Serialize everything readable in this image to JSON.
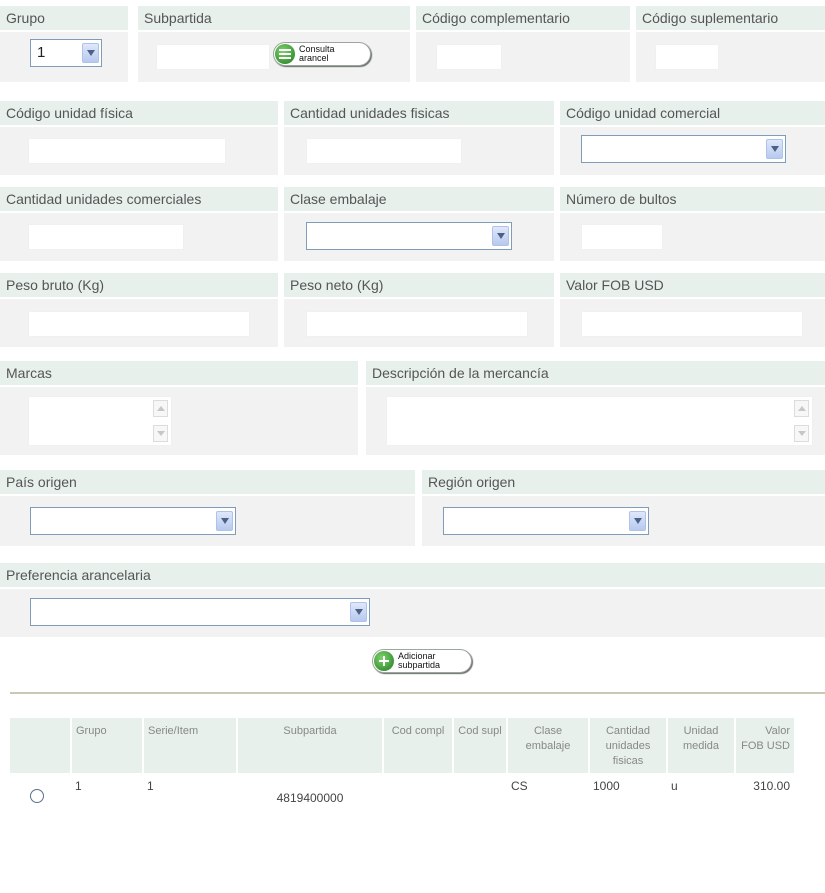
{
  "row1": {
    "grupo": {
      "label": "Grupo",
      "value": "1"
    },
    "subpartida": {
      "label": "Subpartida",
      "button_line1": "Consulta",
      "button_line2": "arancel"
    },
    "codigo_complementario": {
      "label": "Código complementario"
    },
    "codigo_suplementario": {
      "label": "Código suplementario"
    }
  },
  "row2": {
    "codigo_unidad_fisica": {
      "label": "Código unidad física"
    },
    "cantidad_unidades_fisicas": {
      "label": "Cantidad unidades fisicas"
    },
    "codigo_unidad_comercial": {
      "label": "Código unidad comercial"
    }
  },
  "row3": {
    "cantidad_unidades_comerciales": {
      "label": "Cantidad unidades comerciales"
    },
    "clase_embalaje": {
      "label": "Clase embalaje"
    },
    "numero_bultos": {
      "label": "Número de bultos"
    }
  },
  "row4": {
    "peso_bruto": {
      "label": "Peso bruto (Kg)"
    },
    "peso_neto": {
      "label": "Peso neto (Kg)"
    },
    "valor_fob": {
      "label": "Valor FOB USD"
    }
  },
  "row5": {
    "marcas": {
      "label": "Marcas"
    },
    "descripcion": {
      "label": "Descripción de la mercancía"
    }
  },
  "row6": {
    "pais_origen": {
      "label": "País origen"
    },
    "region_origen": {
      "label": "Región origen"
    }
  },
  "row7": {
    "preferencia": {
      "label": "Preferencia arancelaria"
    }
  },
  "add_button": {
    "line1": "Adicionar",
    "line2": "subpartida"
  },
  "table": {
    "headers": {
      "grupo": "Grupo",
      "serie": "Serie/Item",
      "subpartida": "Subpartida",
      "cod_compl": "Cod compl",
      "cod_supl": "Cod supl",
      "clase": "Clase embalaje",
      "cantidad": "Cantidad unidades fisicas",
      "unidad": "Unidad medida",
      "valor": "Valor FOB USD"
    },
    "rows": [
      {
        "grupo": "1",
        "serie": "1",
        "subpartida": "4819400000",
        "cod_compl": "",
        "cod_supl": "",
        "clase": "CS",
        "cantidad": "1000",
        "unidad": "u",
        "valor": "310.00"
      }
    ]
  }
}
